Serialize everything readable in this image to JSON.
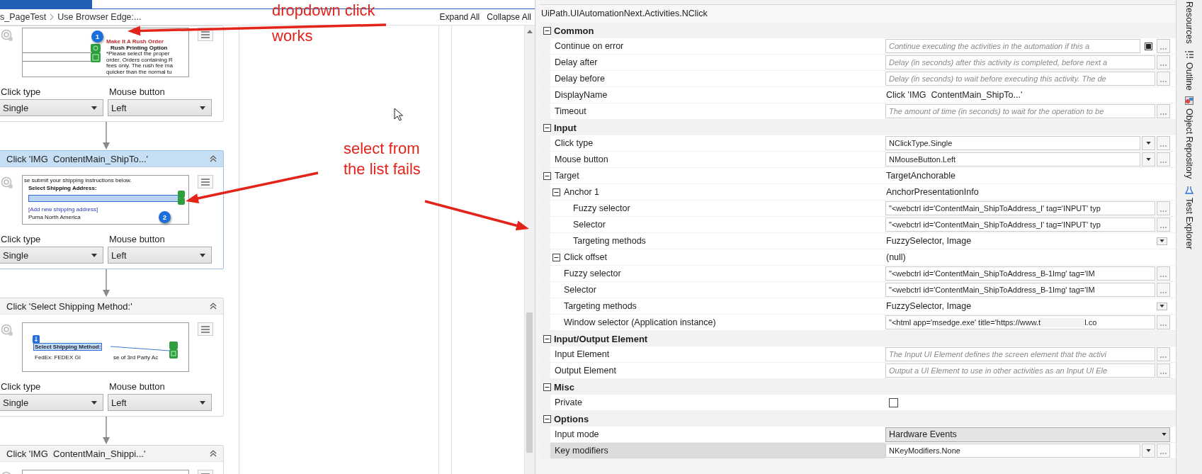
{
  "designer": {
    "breadcrumb": [
      "s_PageTest",
      "Use Browser Edge:..."
    ],
    "expand_all": "Expand All",
    "collapse_all": "Collapse All",
    "activities": [
      {
        "selected": false,
        "preview": {
          "kind": "rush_order",
          "badge": "1",
          "lines": [
            {
              "text": "Make It A Rush Order",
              "kind": "heading"
            },
            {
              "text": "Rush Printing Option",
              "kind": "subheading"
            },
            {
              "text": "*Please select the proper",
              "kind": "normal"
            },
            {
              "text": "order. Orders containing R",
              "kind": "normal"
            },
            {
              "text": "fees only. The rush fee ma",
              "kind": "normal"
            },
            {
              "text": "quicker than the normal tu",
              "kind": "normal"
            }
          ]
        },
        "click_type_label": "Click type",
        "click_type": "Single",
        "mouse_button_label": "Mouse button",
        "mouse_button": "Left"
      },
      {
        "title": "Click 'IMG  ContentMain_ShipTo...'",
        "selected": true,
        "preview": {
          "kind": "address",
          "badge": "2",
          "lines": [
            {
              "text": "se submit your shipping instructions below.",
              "kind": "normal"
            },
            {
              "text": "Select Shipping Address:",
              "kind": "subheading"
            },
            {
              "text": "[Add new shipping address]",
              "kind": "link"
            },
            {
              "text": "Puma North America",
              "kind": "normal"
            }
          ]
        },
        "click_type_label": "Click type",
        "click_type": "Single",
        "mouse_button_label": "Mouse button",
        "mouse_button": "Left"
      },
      {
        "title": "Click 'Select Shipping Method:'",
        "selected": false,
        "preview": {
          "kind": "method",
          "lines": [
            {
              "text": "Select Shipping Method:",
              "kind": "highlight"
            },
            {
              "text": "FedEx: FEDEX GI",
              "kind": "normal"
            },
            {
              "text": "se of 3rd Party Ac",
              "kind": "normal"
            }
          ]
        },
        "click_type_label": "Click type",
        "click_type": "Single",
        "mouse_button_label": "Mouse button",
        "mouse_button": "Left"
      },
      {
        "title": "Click 'IMG  ContentMain_Shippi...'",
        "selected": false,
        "preview": {
          "kind": "blank"
        }
      }
    ]
  },
  "notes": [
    "dropdown click works",
    "select from the list fails"
  ],
  "properties": {
    "title": "UiPath.UIAutomationNext.Activities.NClick",
    "categories": [
      {
        "name": "Common",
        "expanded": true,
        "rows": [
          {
            "label": "Continue on error",
            "kind": "field_check",
            "placeholder": "Continue executing the activities in the automation if this a",
            "checked": true,
            "selected": false
          },
          {
            "label": "Delay after",
            "kind": "field",
            "placeholder": "Delay (in seconds) after this activity is completed, before next a",
            "selected": false
          },
          {
            "label": "Delay before",
            "kind": "field",
            "placeholder": "Delay (in seconds) to wait before executing this activity. The de",
            "selected": false
          },
          {
            "label": "DisplayName",
            "kind": "text",
            "value": "Click 'IMG  ContentMain_ShipTo...'",
            "selected": false
          },
          {
            "label": "Timeout",
            "kind": "field",
            "placeholder": "The amount of time (in seconds) to wait for the operation to be",
            "selected": false
          }
        ]
      },
      {
        "name": "Input",
        "expanded": true,
        "rows": [
          {
            "label": "Click type",
            "kind": "dropdown_field",
            "value": "NClickType.Single",
            "selected": false
          },
          {
            "label": "Mouse button",
            "kind": "dropdown_field",
            "value": "NMouseButton.Left",
            "selected": false
          },
          {
            "label": "Target",
            "kind": "text",
            "value": "TargetAnchorable",
            "expanded": true,
            "selected": false,
            "children": [
              {
                "label": "Anchor 1",
                "kind": "text",
                "value": "AnchorPresentationInfo",
                "expanded": true,
                "selected": false,
                "children": [
                  {
                    "label": "Fuzzy selector",
                    "kind": "field",
                    "value": "\"<webctrl id='ContentMain_ShipToAddress_I' tag='INPUT' typ",
                    "selected": false
                  },
                  {
                    "label": "Selector",
                    "kind": "field",
                    "value": "\"<webctrl id='ContentMain_ShipToAddress_I' tag='INPUT' typ",
                    "selected": false
                  },
                  {
                    "label": "Targeting methods",
                    "kind": "select",
                    "value": "FuzzySelector, Image",
                    "selected": false
                  }
                ]
              },
              {
                "label": "Click offset",
                "kind": "text",
                "value": "(null)",
                "expanded": true,
                "selected": false
              },
              {
                "label": "Fuzzy selector",
                "kind": "field",
                "value": "\"<webctrl id='ContentMain_ShipToAddress_B-1Img' tag='IM",
                "selected": false
              },
              {
                "label": "Selector",
                "kind": "field",
                "value": "\"<webctrl id='ContentMain_ShipToAddress_B-1Img' tag='IM",
                "selected": false
              },
              {
                "label": "Targeting methods",
                "kind": "select",
                "value": "FuzzySelector, Image",
                "selected": false
              },
              {
                "label": "Window selector (Application instance)",
                "kind": "field",
                "value": "\"<html app='msedge.exe' title='https://www.t",
                "value_after_redaction": "l.co",
                "selected": false
              }
            ]
          }
        ]
      },
      {
        "name": "Input/Output Element",
        "expanded": true,
        "rows": [
          {
            "label": "Input Element",
            "kind": "field",
            "placeholder": "The Input UI Element defines the screen element that the activi",
            "selected": false
          },
          {
            "label": "Output Element",
            "kind": "field",
            "placeholder": "Output a UI Element to use in other activities as an Input UI Ele",
            "selected": false
          }
        ]
      },
      {
        "name": "Misc",
        "expanded": true,
        "rows": [
          {
            "label": "Private",
            "kind": "checkbox",
            "checked": false,
            "selected": false
          }
        ]
      },
      {
        "name": "Options",
        "expanded": true,
        "rows": [
          {
            "label": "Input mode",
            "kind": "combo",
            "value": "Hardware Events",
            "selected": false
          },
          {
            "label": "Key modifiers",
            "kind": "dropdown_field",
            "value": "NKeyModifiers.None",
            "selected": true
          }
        ]
      }
    ]
  },
  "side_tabs": [
    {
      "label": "Resources",
      "kind": "plain"
    },
    {
      "label": "Outline",
      "kind": "outline"
    },
    {
      "label": "Object Repository",
      "kind": "repository"
    },
    {
      "label": "Test Explorer",
      "kind": "test"
    }
  ]
}
